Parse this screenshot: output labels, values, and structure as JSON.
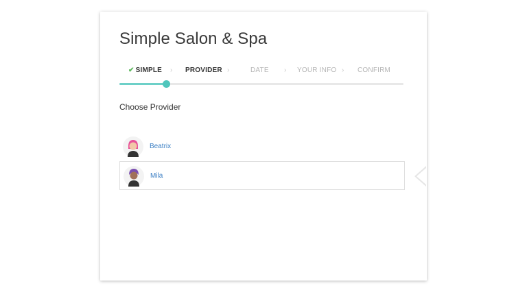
{
  "app": {
    "title": "Simple Salon & Spa"
  },
  "steps": [
    {
      "label": "SIMPLE",
      "state": "done"
    },
    {
      "label": "PROVIDER",
      "state": "active"
    },
    {
      "label": "DATE",
      "state": "todo"
    },
    {
      "label": "YOUR INFO",
      "state": "todo"
    },
    {
      "label": "CONFIRM",
      "state": "todo"
    }
  ],
  "progress": {
    "fraction": 0.164
  },
  "section": {
    "label": "Choose Provider"
  },
  "providers": [
    {
      "name": "Beatrix",
      "hair_color": "#e8549a",
      "skin_color": "#f2c8a8",
      "selected": false
    },
    {
      "name": "Mila",
      "hair_color": "#7b4fb0",
      "skin_color": "#a0705a",
      "selected": true
    }
  ],
  "colors": {
    "accent": "#4fc6bc",
    "link": "#3b7fc4",
    "check": "#5cb85c"
  },
  "icons": {
    "check": "check-icon",
    "separator": "chevron-right-icon"
  }
}
